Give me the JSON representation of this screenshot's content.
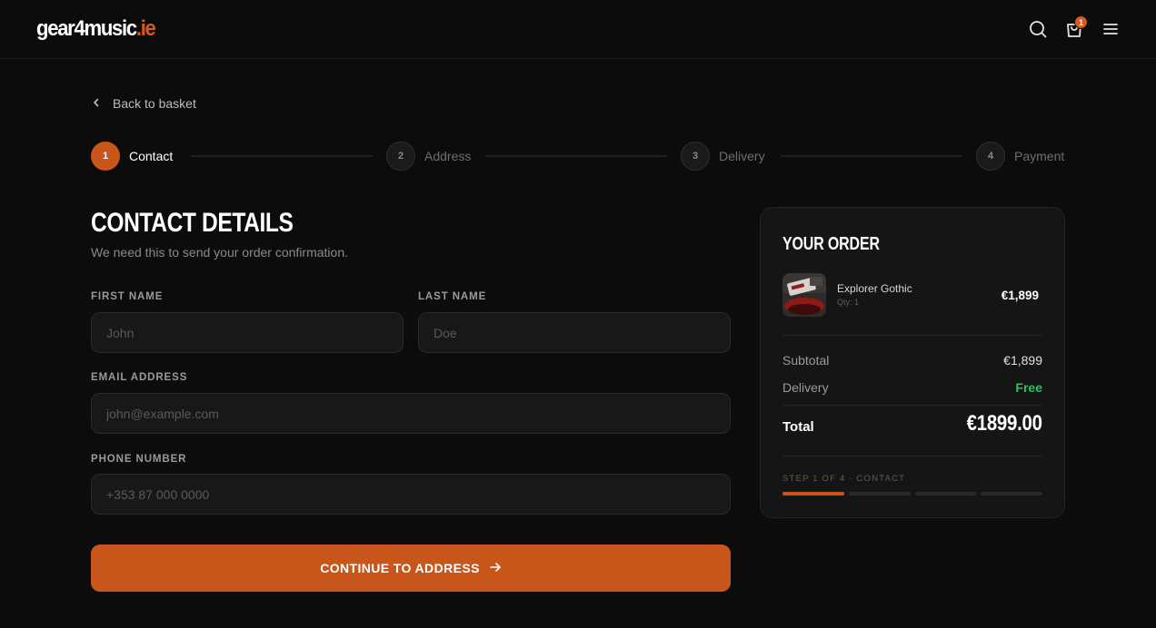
{
  "header": {
    "logo_brand": "gear4music",
    "logo_tld": ".ie",
    "cart_count": "1",
    "icons": [
      "search-icon",
      "cart-icon",
      "menu-icon"
    ]
  },
  "back_link": {
    "label": "Back to basket"
  },
  "stepper": {
    "steps": [
      {
        "number": "1",
        "label": "Contact",
        "active": true
      },
      {
        "number": "2",
        "label": "Address",
        "active": false
      },
      {
        "number": "3",
        "label": "Delivery",
        "active": false
      },
      {
        "number": "4",
        "label": "Payment",
        "active": false
      }
    ]
  },
  "form": {
    "title": "CONTACT DETAILS",
    "subtitle": "We need this to send your order confirmation.",
    "first_name": {
      "label": "FIRST NAME",
      "placeholder": "John",
      "value": ""
    },
    "last_name": {
      "label": "LAST NAME",
      "placeholder": "Doe",
      "value": ""
    },
    "email": {
      "label": "EMAIL ADDRESS",
      "placeholder": "john@example.com",
      "value": ""
    },
    "phone": {
      "label": "PHONE NUMBER",
      "placeholder": "+353 87 000 0000",
      "value": ""
    },
    "submit_label": "CONTINUE TO ADDRESS"
  },
  "order": {
    "title": "YOUR ORDER",
    "item": {
      "name": "Explorer Gothic",
      "qty": "Qty: 1",
      "price": "€1,899"
    },
    "subtotal_label": "Subtotal",
    "subtotal_value": "€1,899",
    "delivery_label": "Delivery",
    "delivery_value": "Free",
    "total_label": "Total",
    "total_value": "€1899.00",
    "step_caption": "STEP 1 OF 4 · CONTACT",
    "progress_total": 4,
    "progress_done": 1
  },
  "colors": {
    "accent": "#c8561b",
    "success": "#22c55e",
    "background": "#0c0c0c",
    "card": "#151515"
  }
}
